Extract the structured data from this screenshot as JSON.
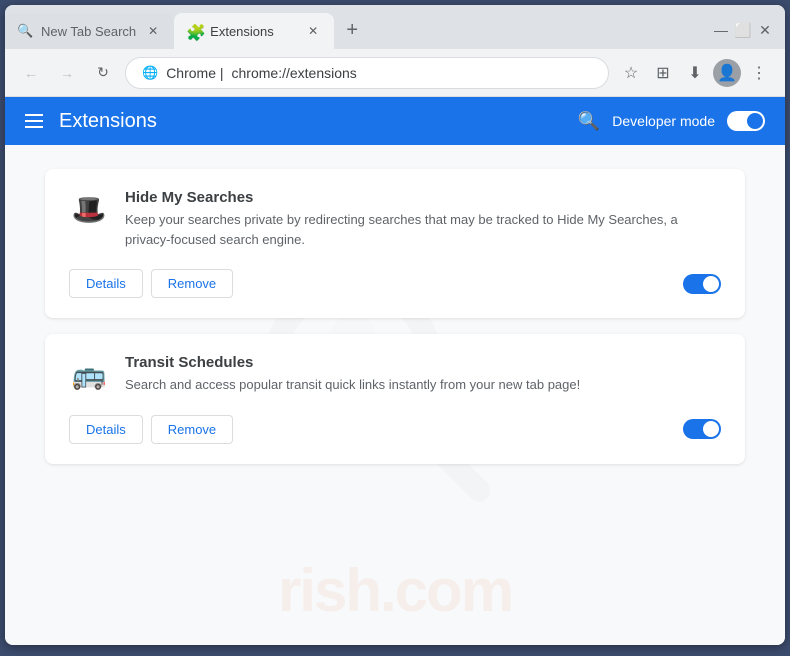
{
  "browser": {
    "tabs": [
      {
        "id": "tab-1",
        "title": "New Tab Search",
        "icon": "🔍",
        "active": false
      },
      {
        "id": "tab-2",
        "title": "Extensions",
        "icon": "🧩",
        "active": true
      }
    ],
    "address": {
      "domain": "Chrome  |  ",
      "path": "chrome://extensions",
      "icon": "🌐"
    },
    "window_controls": {
      "minimize": "—",
      "maximize": "⬜",
      "close": "✕"
    }
  },
  "extensions_header": {
    "menu_label": "menu",
    "title": "Extensions",
    "search_label": "search",
    "developer_mode_label": "Developer mode"
  },
  "extensions": [
    {
      "id": "ext-1",
      "name": "Hide My Searches",
      "description": "Keep your searches private by redirecting searches that may be tracked to Hide My Searches, a privacy-focused search engine.",
      "icon": "🎩",
      "enabled": true,
      "details_label": "Details",
      "remove_label": "Remove"
    },
    {
      "id": "ext-2",
      "name": "Transit Schedules",
      "description": "Search and access popular transit quick links instantly from your new tab page!",
      "icon": "🚌",
      "enabled": true,
      "details_label": "Details",
      "remove_label": "Remove"
    }
  ],
  "watermark": {
    "text": "rish.com"
  }
}
